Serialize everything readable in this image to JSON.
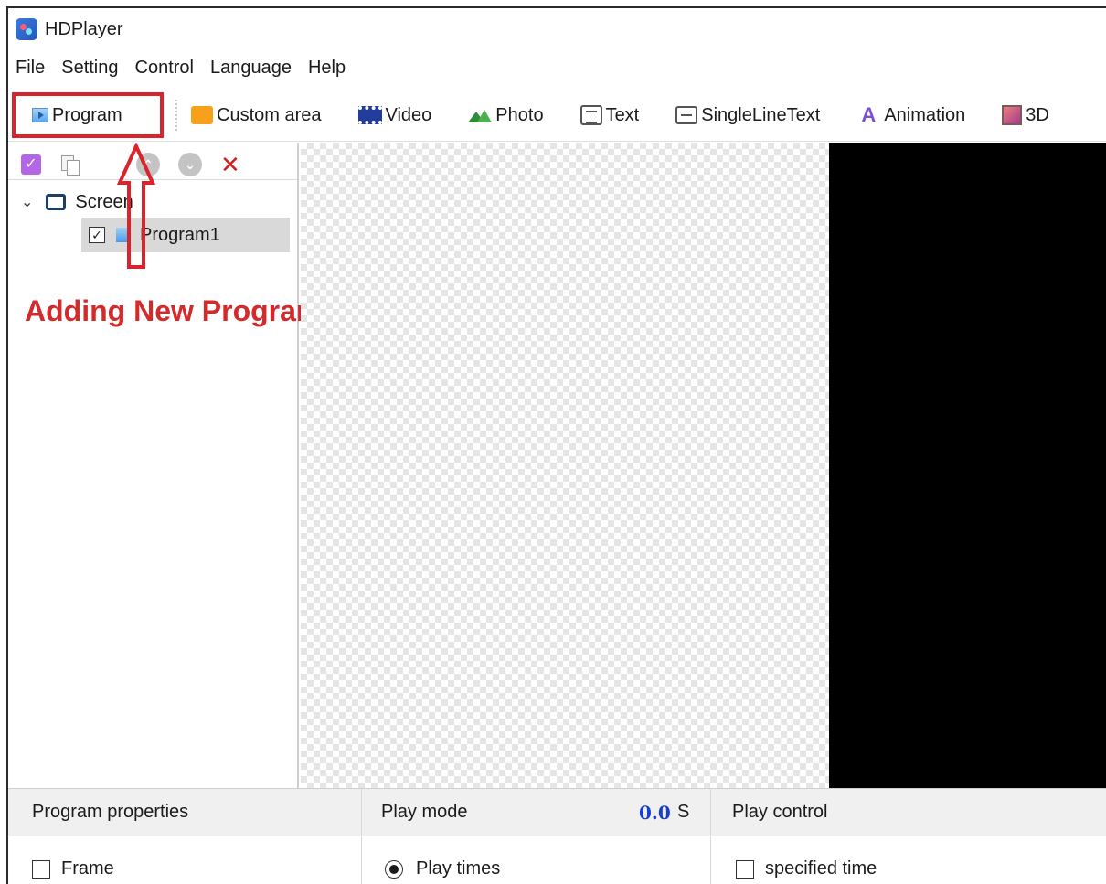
{
  "window": {
    "title": "HDPlayer"
  },
  "menu": [
    "File",
    "Setting",
    "Control",
    "Language",
    "Help"
  ],
  "toolbar": {
    "program": "Program",
    "custom_area": "Custom area",
    "video": "Video",
    "photo": "Photo",
    "text": "Text",
    "single_line_text": "SingleLineText",
    "animation": "Animation",
    "three_d": "3D"
  },
  "tree": {
    "screen_label": "Screen",
    "program_label": "Program1",
    "program_checked": true
  },
  "annotation": {
    "text": "Adding New Program",
    "color": "#d32a2c"
  },
  "bottom": {
    "program_properties": "Program properties",
    "play_mode": "Play mode",
    "play_mode_value": "0.0",
    "play_mode_unit": "S",
    "play_control": "Play control",
    "frame_label": "Frame",
    "play_times_label": "Play times",
    "specified_time_label": "specified time"
  },
  "colors": {
    "accent_red": "#d9232d",
    "value_blue": "#1a3fcc"
  }
}
